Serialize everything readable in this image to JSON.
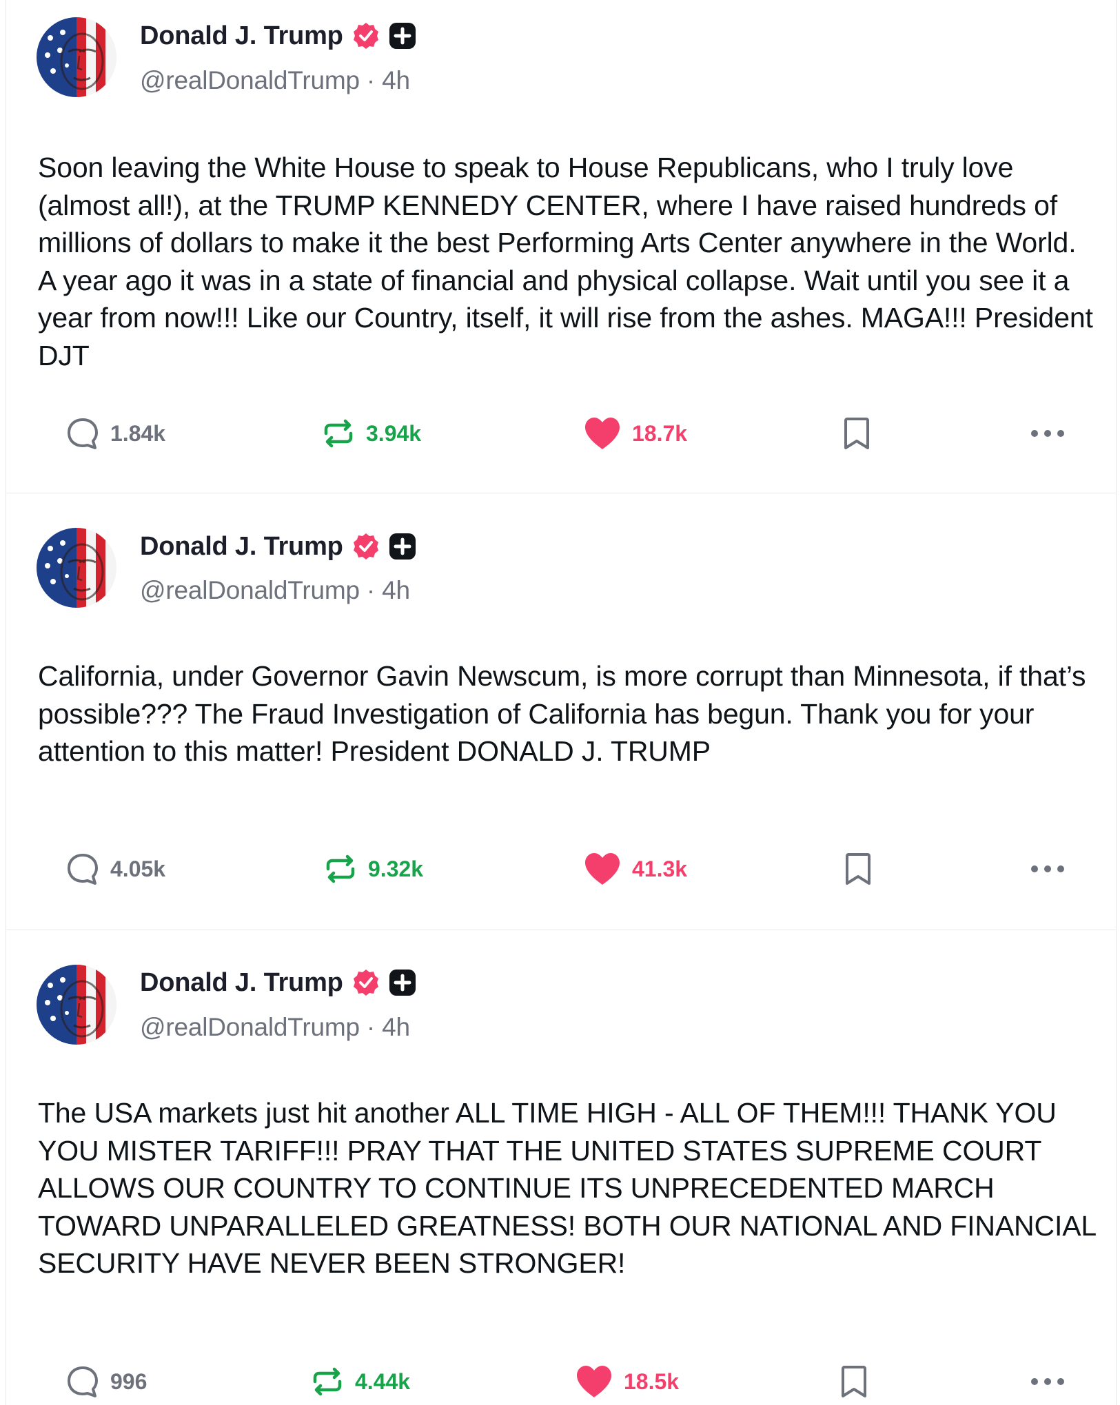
{
  "colors": {
    "verified": "#f43f6c",
    "repost": "#17a34a",
    "like": "#f43f6c",
    "muted": "#6c717b",
    "text": "#0f1419"
  },
  "icons": [
    "avatar-image",
    "verified-badge-icon",
    "plus-badge-icon",
    "reply-icon",
    "repost-icon",
    "heart-icon",
    "bookmark-icon",
    "more-options-icon"
  ],
  "posts": [
    {
      "author": "Donald J. Trump",
      "handle_time": "@realDonaldTrump · 4h",
      "text": "Soon leaving the White House to speak to House Republicans, who I truly love (almost all!), at the TRUMP KENNEDY CENTER, where I have raised hundreds of millions of dollars to make it the best Performing Arts Center anywhere in the World. A year ago it was in a state of financial and physical collapse. Wait until you see it a year from now!!! Like our Country, itself, it will rise from the ashes. MAGA!!! President DJT",
      "replies": "1.84k",
      "reposts": "3.94k",
      "likes": "18.7k"
    },
    {
      "author": "Donald J. Trump",
      "handle_time": "@realDonaldTrump · 4h",
      "text": "California, under Governor Gavin Newscum, is more corrupt than Minnesota, if that’s possible??? The Fraud Investigation of California has begun. Thank you for your attention to this matter! President DONALD J. TRUMP",
      "replies": "4.05k",
      "reposts": "9.32k",
      "likes": "41.3k"
    },
    {
      "author": "Donald J. Trump",
      "handle_time": "@realDonaldTrump · 4h",
      "text": "The USA markets just hit another ALL TIME HIGH - ALL OF THEM!!! THANK YOU YOU MISTER TARIFF!!! PRAY THAT THE UNITED STATES SUPREME COURT ALLOWS OUR COUNTRY TO CONTINUE ITS UNPRECEDENTED MARCH TOWARD UNPARALLELED GREATNESS! BOTH OUR NATIONAL AND FINANCIAL SECURITY HAVE NEVER BEEN STRONGER!",
      "replies": "996",
      "reposts": "4.44k",
      "likes": "18.5k"
    }
  ]
}
